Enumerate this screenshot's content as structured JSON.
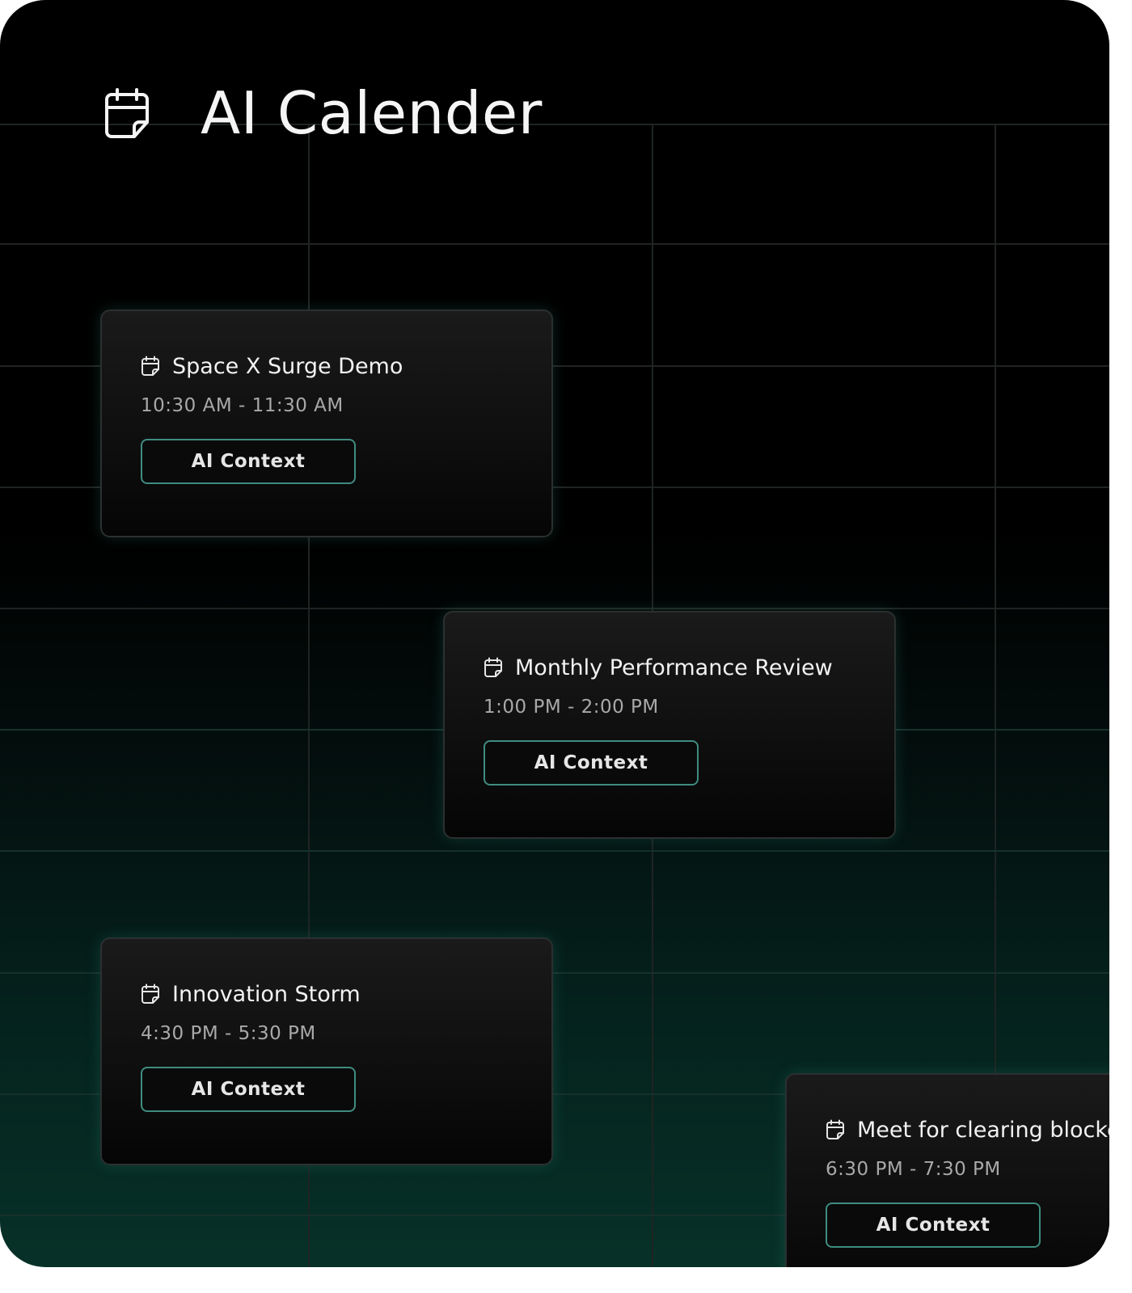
{
  "header": {
    "title": "AI Calender",
    "icon": "calendar-icon"
  },
  "events": [
    {
      "title": "Space X Surge Demo",
      "time": "10:30 AM - 11:30 AM",
      "button_label": "AI Context"
    },
    {
      "title": "Monthly Performance Review",
      "time": "1:00 PM - 2:00 PM",
      "button_label": "AI Context"
    },
    {
      "title": "Innovation Storm",
      "time": "4:30 PM - 5:30 PM",
      "button_label": "AI Context"
    },
    {
      "title": "Meet for clearing blockers",
      "time": "6:30 PM - 7:30 PM",
      "button_label": "AI Context"
    }
  ],
  "colors": {
    "background": "#000000",
    "background_bottom": "#073128",
    "button_border": "#3f8c80",
    "text_primary": "#f2f2f2",
    "text_secondary": "#a9a9a9"
  }
}
